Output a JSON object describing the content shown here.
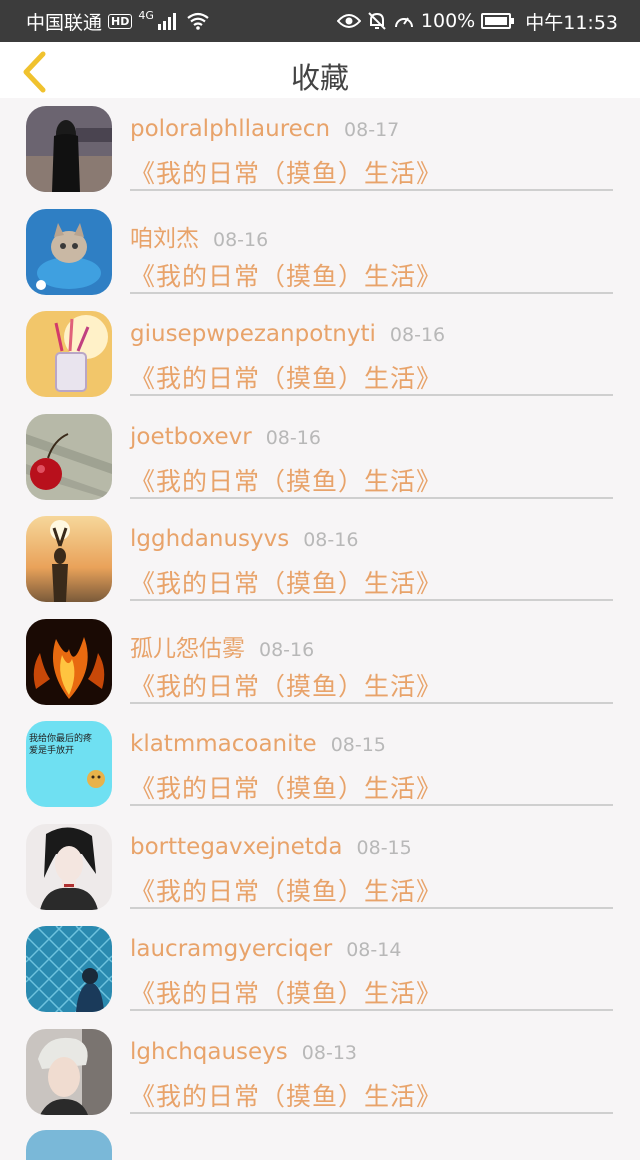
{
  "status_bar": {
    "carrier": "中国联通",
    "hd": "HD",
    "network": "4G",
    "battery": "100%",
    "time": "中午11:53"
  },
  "header": {
    "title": "收藏"
  },
  "favorites": [
    {
      "username": "poloralphllaurecn",
      "date": "08-17",
      "title": "《我的日常（摸鱼）生活》"
    },
    {
      "username": "咱刘杰",
      "date": "08-16",
      "title": "《我的日常（摸鱼）生活》"
    },
    {
      "username": "giusepwpezanpotnyti",
      "date": "08-16",
      "title": "《我的日常（摸鱼）生活》"
    },
    {
      "username": "joetboxevr",
      "date": "08-16",
      "title": "《我的日常（摸鱼）生活》"
    },
    {
      "username": "lgghdanusyvs",
      "date": "08-16",
      "title": "《我的日常（摸鱼）生活》"
    },
    {
      "username": "孤儿怨估雾",
      "date": "08-16",
      "title": "《我的日常（摸鱼）生活》"
    },
    {
      "username": "klatmmacoanite",
      "date": "08-15",
      "title": "《我的日常（摸鱼）生活》"
    },
    {
      "username": "borttegavxejnetda",
      "date": "08-15",
      "title": "《我的日常（摸鱼）生活》"
    },
    {
      "username": "laucramgyerciqer",
      "date": "08-14",
      "title": "《我的日常（摸鱼）生活》"
    },
    {
      "username": "lghchqauseys",
      "date": "08-13",
      "title": "《我的日常（摸鱼）生活》"
    }
  ],
  "avatar_6_text": "我给你最后的疼爱是手放开",
  "colors": {
    "accent": "#e8a36a",
    "back_arrow": "#f0c22e",
    "date": "#b8b8b8",
    "status_bar": "#3c3c3c"
  }
}
